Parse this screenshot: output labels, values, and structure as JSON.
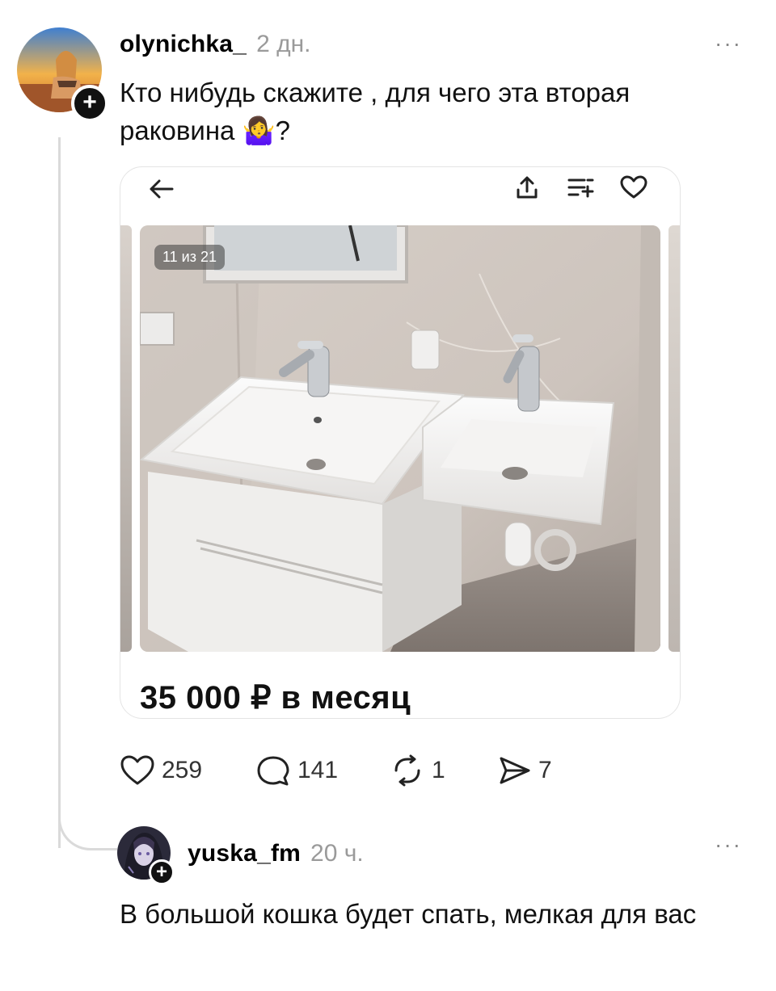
{
  "post": {
    "username": "olynichka_",
    "time": "2 дн.",
    "text": "Кто нибудь скажите , для чего эта вторая раковина 🤷‍♀️?",
    "more": "···"
  },
  "card": {
    "photo_counter": "11 из 21",
    "price": "35 000 ₽ в месяц"
  },
  "actions": {
    "likes": "259",
    "comments": "141",
    "reposts": "1",
    "shares": "7"
  },
  "reply": {
    "username": "yuska_fm",
    "time": "20 ч.",
    "text": "В большой кошка будет спать, мелкая для вас",
    "more": "···"
  },
  "colors": {
    "thread_line": "#dadada",
    "time_gray": "#9a9a9a"
  }
}
